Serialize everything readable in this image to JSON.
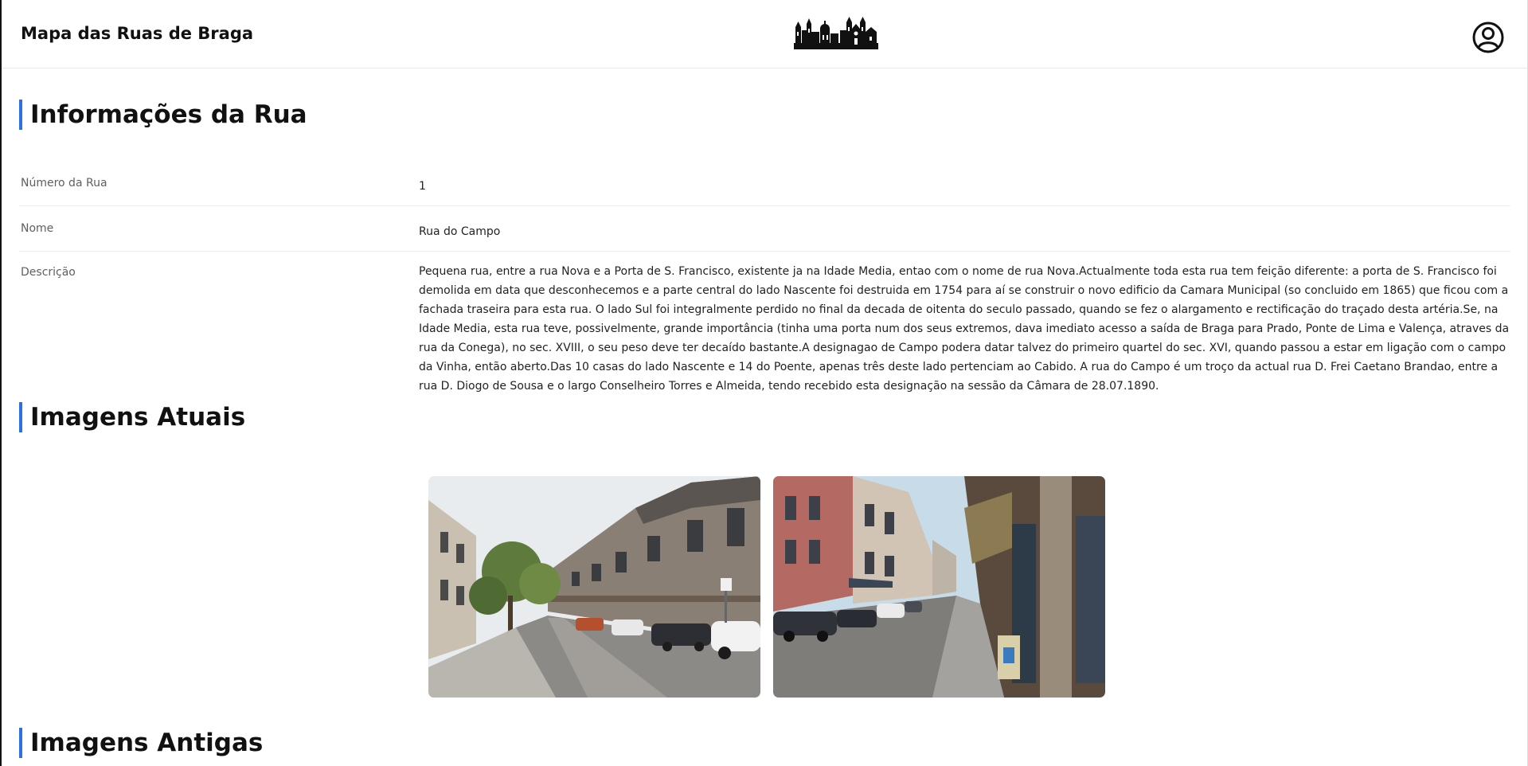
{
  "header": {
    "title": "Mapa das Ruas de Braga",
    "logo_icon": "braga-skyline-icon",
    "user_icon": "user-circle-icon"
  },
  "info_section": {
    "heading": "Informações da Rua",
    "rows": [
      {
        "label": "Número da Rua",
        "value": "1"
      },
      {
        "label": "Nome",
        "value": "Rua do Campo"
      },
      {
        "label": "Descrição",
        "value": "Pequena rua, entre a rua Nova e a Porta de S. Francisco, existente ja na Idade Media, entao com o nome de rua Nova.Actualmente toda esta rua tem feição diferente: a porta de S. Francisco foi demolida em data que desconhecemos e a parte central do lado Nascente foi destruida em 1754 para aí se construir o novo edificio da Camara Municipal (so concluido em 1865) que ficou com a fachada traseira para esta rua. O lado Sul foi integralmente perdido no final da decada de oitenta do seculo passado, quando se fez o alargamento e rectificação do traçado desta artéria.Se, na Idade Media, esta rua teve, possivelmente, grande importância (tinha uma porta num dos seus extremos, dava imediato acesso a saída de Braga para Prado, Ponte de Lima e Valença, atraves da rua da Conega), no sec. XVIII, o seu peso deve ter decaído bastante.A designagao de Campo podera datar talvez do primeiro quartel do sec. XVI, quando passou a estar em ligação com o campo da Vinha, então aberto.Das 10 casas do lado Nascente e 14 do Poente, apenas três deste lado pertenciam ao Cabido. A rua do Campo é um troço da actual rua D. Frei Caetano Brandao, entre a rua D. Diogo de Sousa e o largo Conselheiro Torres e Almeida, tendo recebido esta designação na sessão da Câmara de 28.07.1890."
      }
    ]
  },
  "current_images": {
    "heading": "Imagens Atuais",
    "images": [
      {
        "name": "street-photo-1"
      },
      {
        "name": "street-photo-2"
      }
    ]
  },
  "old_images": {
    "heading": "Imagens Antigas"
  },
  "colors": {
    "accent": "#2f6fde",
    "text": "#111111",
    "label": "#5f5f5f"
  }
}
